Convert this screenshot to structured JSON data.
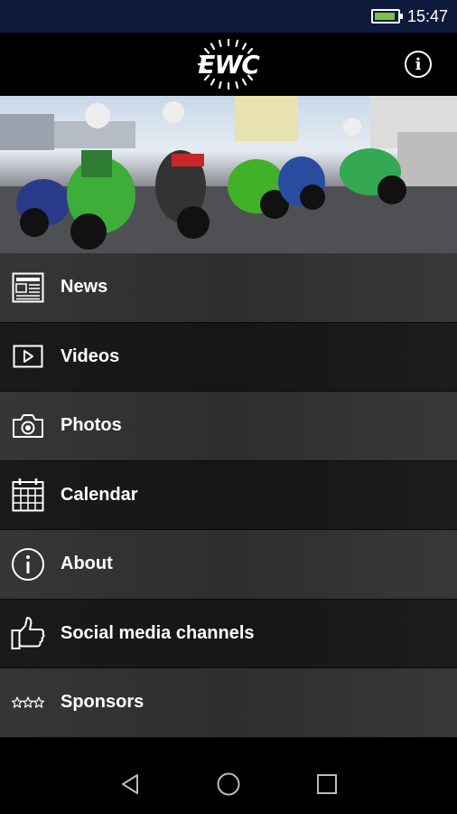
{
  "status_bar": {
    "time": "15:47",
    "icons": [
      "battery-charging-icon"
    ]
  },
  "app_bar": {
    "logo_text": "EWC",
    "info_icon": "info-icon"
  },
  "hero": {
    "image": "motorcycle-riders-photo"
  },
  "menu": {
    "items": [
      {
        "label": "News",
        "icon": "newspaper-icon"
      },
      {
        "label": "Videos",
        "icon": "video-play-icon"
      },
      {
        "label": "Photos",
        "icon": "camera-icon"
      },
      {
        "label": "Calendar",
        "icon": "calendar-icon"
      },
      {
        "label": "About",
        "icon": "info-circle-icon"
      },
      {
        "label": "Social media channels",
        "icon": "thumbs-up-icon"
      },
      {
        "label": "Sponsors",
        "icon": "stars-icon"
      }
    ]
  },
  "nav_bar": {
    "icons": [
      "back-icon",
      "home-icon",
      "recents-icon"
    ]
  },
  "colors": {
    "status_bar": "#0d1a3b",
    "battery": "#7bc142",
    "background": "#000000"
  }
}
